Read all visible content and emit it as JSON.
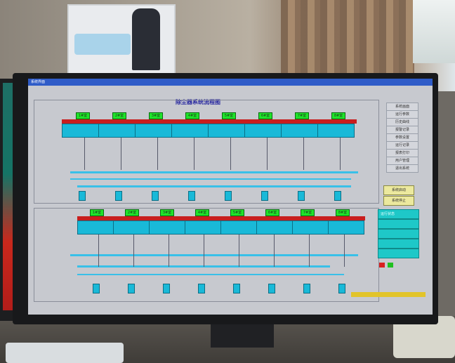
{
  "window": {
    "title": "系统界面"
  },
  "screen": {
    "title": "除尘器系统流程图",
    "upper_units": [
      "1#室",
      "2#室",
      "3#室",
      "4#室",
      "5#室",
      "6#室",
      "7#室",
      "8#室"
    ],
    "lower_units": [
      "1#室",
      "2#室",
      "3#室",
      "4#室",
      "5#室",
      "6#室",
      "7#室",
      "8#室"
    ]
  },
  "side_menu": [
    "系统画面",
    "运行参数",
    "历史曲线",
    "报警记录",
    "参数设置",
    "运行记录",
    "报表打印",
    "用户管理",
    "退出系统"
  ],
  "control_buttons": [
    "系统启动",
    "系统停止"
  ],
  "status_panel": {
    "rows": [
      "运行状态",
      "",
      "",
      "",
      ""
    ]
  },
  "room": {
    "poster_text": "",
    "keyboard_label": ""
  },
  "colors": {
    "dust_hopper": "#19b9d8",
    "header_pipe": "#c81e1e",
    "valve_on": "#1fe32a",
    "panel": "#1ec8c8",
    "titlebar": "#2f5cc8"
  }
}
